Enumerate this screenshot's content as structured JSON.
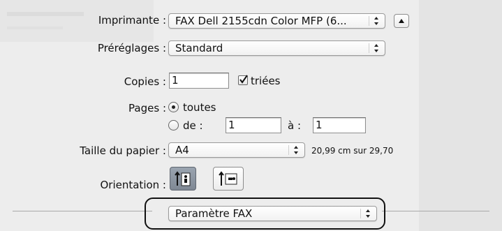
{
  "printer": {
    "label": "Imprimante :",
    "value": "FAX Dell 2155cdn Color MFP (6...",
    "disclosure_icon": "triangle-up-icon"
  },
  "presets": {
    "label": "Préréglages :",
    "value": "Standard"
  },
  "copies": {
    "label": "Copies :",
    "value": "1",
    "collate_checked": true,
    "collate_label": "triées"
  },
  "pages": {
    "label": "Pages :",
    "all_label": "toutes",
    "all_selected": true,
    "range_from_label": "de :",
    "range_from_value": "1",
    "range_to_label": "à :",
    "range_to_value": "1"
  },
  "paper_size": {
    "label": "Taille du papier :",
    "value": "A4",
    "dimensions": "20,99 cm sur 29,70"
  },
  "orientation": {
    "label": "Orientation :",
    "options": [
      {
        "name": "portrait",
        "selected": true
      },
      {
        "name": "landscape",
        "selected": false
      }
    ]
  },
  "panel_menu": {
    "value": "Paramètre FAX"
  }
}
